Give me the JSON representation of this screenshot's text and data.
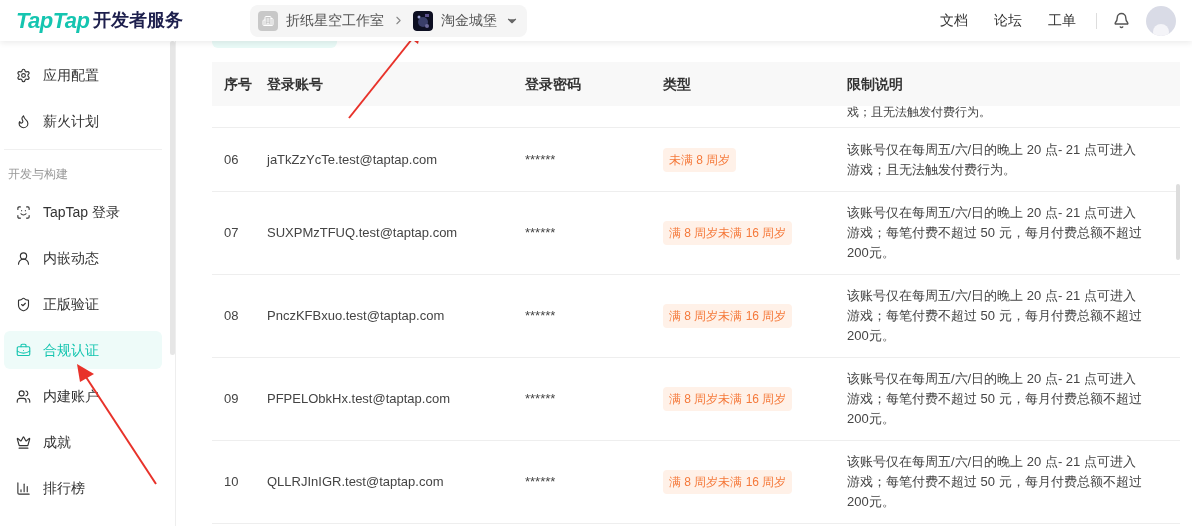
{
  "header": {
    "logo_brand": "TapTap",
    "logo_suffix": "开发者服务",
    "breadcrumb": [
      {
        "label": "折纸星空工作室",
        "kind": "studio"
      },
      {
        "label": "淘金城堡",
        "kind": "game"
      }
    ],
    "nav_links": [
      "文档",
      "论坛",
      "工单"
    ]
  },
  "sidebar": {
    "items": [
      {
        "label": "应用配置",
        "selected": false
      },
      {
        "label": "薪火计划",
        "selected": false
      }
    ],
    "section_title": "开发与构建",
    "section_items": [
      {
        "label": "TapTap 登录",
        "selected": false
      },
      {
        "label": "内嵌动态",
        "selected": false
      },
      {
        "label": "正版验证",
        "selected": false
      },
      {
        "label": "合规认证",
        "selected": true
      },
      {
        "label": "内建账户",
        "selected": false
      },
      {
        "label": "成就",
        "selected": false
      },
      {
        "label": "排行榜",
        "selected": false
      }
    ]
  },
  "table": {
    "columns": [
      "序号",
      "登录账号",
      "登录密码",
      "类型",
      "限制说明"
    ],
    "partial_row_text": "戏；且无法触发付费行为。",
    "rows": [
      {
        "index": "06",
        "account": "jaTkZzYcTe.test@taptap.com",
        "password": "******",
        "type": "未满 8 周岁",
        "restriction": "该账号仅在每周五/六/日的晚上 20 点- 21 点可进入游戏；且无法触发付费行为。"
      },
      {
        "index": "07",
        "account": "SUXPMzTFUQ.test@taptap.com",
        "password": "******",
        "type": "满 8 周岁未满 16 周岁",
        "restriction": "该账号仅在每周五/六/日的晚上 20 点- 21 点可进入游戏；每笔付费不超过 50 元，每月付费总额不超过 200元。"
      },
      {
        "index": "08",
        "account": "PnczKFBxuo.test@taptap.com",
        "password": "******",
        "type": "满 8 周岁未满 16 周岁",
        "restriction": "该账号仅在每周五/六/日的晚上 20 点- 21 点可进入游戏；每笔付费不超过 50 元，每月付费总额不超过 200元。"
      },
      {
        "index": "09",
        "account": "PFPELObkHx.test@taptap.com",
        "password": "******",
        "type": "满 8 周岁未满 16 周岁",
        "restriction": "该账号仅在每周五/六/日的晚上 20 点- 21 点可进入游戏；每笔付费不超过 50 元，每月付费总额不超过 200元。"
      },
      {
        "index": "10",
        "account": "QLLRJInIGR.test@taptap.com",
        "password": "******",
        "type": "满 8 周岁未满 16 周岁",
        "restriction": "该账号仅在每周五/六/日的晚上 20 点- 21 点可进入游戏；每笔付费不超过 50 元，每月付费总额不超过 200元。"
      }
    ]
  }
}
